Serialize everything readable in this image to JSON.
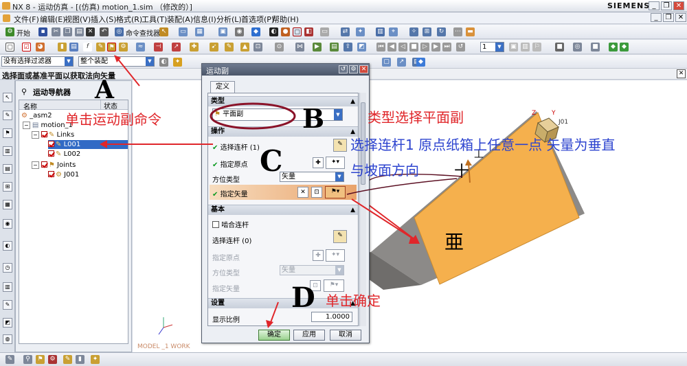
{
  "window": {
    "title": "NX 8 - 运动仿真 - [(仿真) motion_1.sim （修改的）]",
    "brand": "SIEMENS"
  },
  "menubar": [
    "文件(F)",
    "编辑(E)",
    "视图(V)",
    "插入(S)",
    "格式(R)",
    "工具(T)",
    "装配(A)",
    "信息(I)",
    "分析(L)",
    "首选项(P)",
    "帮助(H)"
  ],
  "toolbar1": {
    "start_label": "开始",
    "command_finder_label": "命令查找器"
  },
  "selection_bar": {
    "filter_value": "没有选择过滤器",
    "scope_value": "整个装配"
  },
  "toolbar2": {
    "page_value": "1"
  },
  "status_line": "选择面或基准平面以获取法向矢量",
  "navigator": {
    "title": "运动导航器",
    "col_name": "名称",
    "col_status": "状态",
    "tree": [
      {
        "label": "_asm2",
        "level": 0,
        "checkbox": false
      },
      {
        "label": "motion_1",
        "level": 1,
        "checkbox": false
      },
      {
        "label": "Links",
        "level": 2,
        "checkbox": true
      },
      {
        "label": "L001",
        "level": 3,
        "checkbox": true,
        "selected": true
      },
      {
        "label": "L002",
        "level": 3,
        "checkbox": true
      },
      {
        "label": "Joints",
        "level": 2,
        "checkbox": true
      },
      {
        "label": "J001",
        "level": 3,
        "checkbox": true
      }
    ]
  },
  "dialog": {
    "title": "运动副",
    "tab": "定义",
    "sec_type": "类型",
    "type_value": "平面副",
    "sec_action": "操作",
    "select_link": "选择连杆 (1)",
    "specify_origin": "指定原点",
    "orient_type": "方位类型",
    "orient_value": "矢量",
    "specify_vector": "指定矢量",
    "sec_base": "基本",
    "snap_link": "啮合连杆",
    "base_select_link": "选择连杆 (0)",
    "base_specify_origin": "指定原点",
    "base_orient_type": "方位类型",
    "base_orient_value": "矢量",
    "base_specify_vector": "指定矢量",
    "sec_settings": "设置",
    "display_scale": "显示比例",
    "display_scale_value": "1.0000",
    "ok": "确定",
    "apply": "应用",
    "cancel": "取消"
  },
  "annotations": {
    "a_letter": "A",
    "a_text": "单击运动副命令",
    "b_letter": "B",
    "b_text": "类型选择平面副",
    "c_letter": "C",
    "c_text_line1": "选择连杆1 原点纸箱上任意一点 矢量为垂直",
    "c_text_line2": "与坡面方向",
    "d_letter": "D",
    "d_text": "单击确定"
  },
  "viewport": {
    "model_label": "MODEL _1 WORK",
    "axis_z": "Z",
    "axis_y": "Y",
    "joint_label": "J01"
  },
  "colors": {
    "annotation_red": "#e0262a",
    "annotation_blue": "#2c43cf",
    "slope": "#f5b04d",
    "slope_side": "#8c8a88"
  }
}
